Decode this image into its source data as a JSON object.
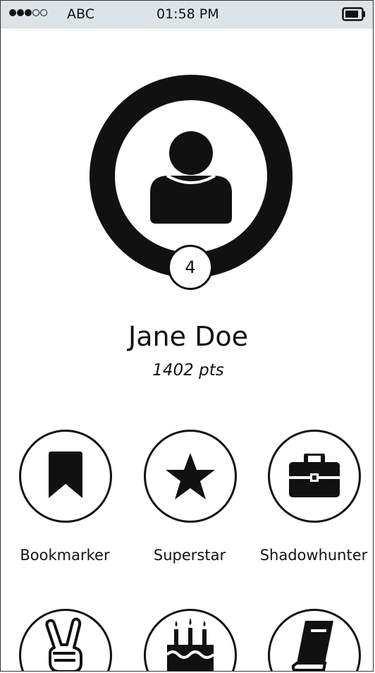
{
  "status_bar": {
    "carrier": "ABC",
    "time": "01:58 PM",
    "signal_bars": 3,
    "signal_total": 5
  },
  "profile": {
    "name": "Jane Doe",
    "points": "1402 pts",
    "level": "4",
    "avatar_icon": "user-icon"
  },
  "badges": [
    {
      "label": "Bookmarker",
      "icon": "bookmark-icon"
    },
    {
      "label": "Superstar",
      "icon": "star-icon"
    },
    {
      "label": "Shadowhunter",
      "icon": "briefcase-icon"
    },
    {
      "label": "",
      "icon": "peace-hand-icon"
    },
    {
      "label": "",
      "icon": "birthday-cake-icon"
    },
    {
      "label": "",
      "icon": "book-icon"
    }
  ],
  "colors": {
    "status_bar_bg": "#dde3e6",
    "ink": "#111111",
    "background": "#ffffff"
  }
}
